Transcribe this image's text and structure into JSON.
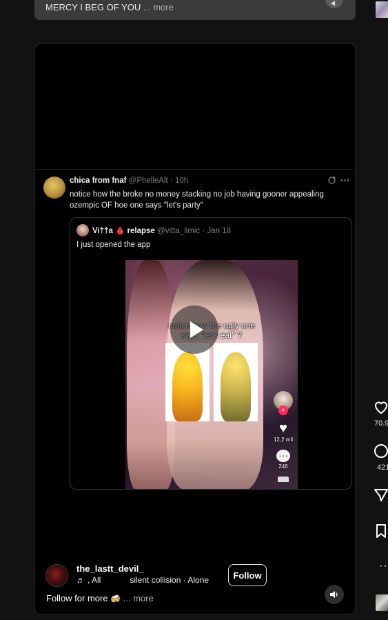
{
  "previous_post": {
    "caption": "MERCY I BEG OF YOU",
    "more_label": "... more"
  },
  "tweet": {
    "author_name": "chica from fnaf",
    "author_handle": "@PhelleAlt",
    "time": "10h",
    "text": "notice how the broke no money stacking no job having gooner appealing ozempic OF hoe one says \"let's party\"",
    "quote": {
      "author_name": "Vi††a 🩸 relapse",
      "author_handle": "@vitta_limic",
      "date": "Jan 18",
      "text": "I just opened the app",
      "video": {
        "overlay_text": "notice how the ugly one says \"let's eat\" ?",
        "like_count": "12,2 mil",
        "comment_count": "246"
      }
    }
  },
  "post": {
    "author": "the_lastt_devil_",
    "music_prefix": ", All",
    "music_title": "silent collision · Alone",
    "follow_label": "Follow",
    "caption": "Follow for more",
    "caption_emoji": "🍻",
    "more_label": "... more"
  },
  "actions": {
    "like_count": "70.9",
    "comment_count": "421"
  },
  "icons": {
    "volume": "volume-icon",
    "play": "play-icon",
    "repost": "repost-icon",
    "more": "more-dots-icon",
    "heart": "heart-icon",
    "comment": "comment-icon",
    "share": "share-icon",
    "bookmark": "bookmark-icon",
    "music": "music-note-icon"
  },
  "colors": {
    "background": "#121212",
    "card": "#000000",
    "tiktok_red": "#fe2c55"
  }
}
